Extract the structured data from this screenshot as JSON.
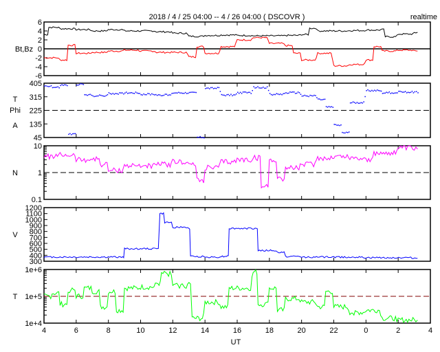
{
  "chart_data": {
    "type": "line",
    "title": "2018 / 4 / 25  04:00 -- 4 / 26  04:00 ( DSCOVR )",
    "mode_label": "realtime",
    "xlabel": "UT",
    "x_ticks": [
      "4",
      "6",
      "8",
      "10",
      "12",
      "14",
      "16",
      "18",
      "20",
      "22",
      "0",
      "2",
      "4"
    ],
    "xlim_hours": [
      4,
      28
    ],
    "panels": [
      {
        "ylabel": "Bt,Bz",
        "scale": "linear",
        "ylim": [
          -6,
          6
        ],
        "ticks": [
          "6",
          "4",
          "2",
          "0",
          "-2",
          "-4",
          "-6"
        ],
        "tick_values": [
          6,
          4,
          2,
          0,
          -2,
          -4,
          -6
        ],
        "ref_line": 0,
        "ref_style": "solid",
        "series": [
          {
            "name": "Bt",
            "color": "#000000",
            "x": [
              4,
              4.3,
              5,
              6,
              7,
              8,
              9,
              10,
              11,
              12,
              13,
              14,
              15,
              16,
              17,
              18,
              19,
              20,
              20.5,
              21,
              22,
              23,
              24,
              25,
              25.2,
              26,
              27,
              27.2
            ],
            "y": [
              3.2,
              4.8,
              4.5,
              4.3,
              4.0,
              4.3,
              4.0,
              4.0,
              3.8,
              3.5,
              2.8,
              3.0,
              3.1,
              3.0,
              2.9,
              2.9,
              3.0,
              3.2,
              4.6,
              4.0,
              4.0,
              4.1,
              4.2,
              4.3,
              2.7,
              3.3,
              3.5,
              3.7
            ]
          },
          {
            "name": "Bz",
            "color": "#ff0000",
            "x": [
              4,
              5,
              5.5,
              6,
              7,
              8,
              9,
              10,
              11,
              12,
              13,
              13.5,
              14,
              15,
              16,
              17,
              18,
              19,
              19.5,
              20,
              21,
              22,
              23,
              24,
              24.5,
              25,
              26,
              27,
              27.2
            ],
            "y": [
              -2,
              -2.5,
              0.8,
              -1,
              -0.8,
              -0.5,
              -0.3,
              -0.5,
              -0.8,
              -0.8,
              -1.8,
              0.5,
              -1,
              0.5,
              2,
              2.5,
              1.2,
              0.7,
              -1,
              -2.5,
              -1,
              -3.8,
              -3.5,
              -2.5,
              0.5,
              -0.5,
              -0.3,
              -0.5,
              -0.5
            ]
          }
        ]
      },
      {
        "ylabel": "T\nPhi\nA",
        "scale": "linear",
        "ylim": [
          45,
          405
        ],
        "ticks": [
          "405",
          "315",
          "225",
          "135",
          "45"
        ],
        "tick_values": [
          405,
          315,
          225,
          135,
          45
        ],
        "ref_line": 225,
        "ref_style": "dashed",
        "series": [
          {
            "name": "Phi",
            "color": "#0000ff",
            "style": "dots",
            "x": [
              4,
              4.5,
              5,
              5.5,
              6,
              6.5,
              7,
              8,
              9,
              10,
              11,
              12,
              13,
              13.5,
              14,
              15,
              16,
              17,
              18,
              19,
              20,
              21,
              21.5,
              22,
              22.5,
              23,
              24,
              25,
              26,
              27,
              27.2
            ],
            "y": [
              390,
              380,
              395,
              70,
              400,
              330,
              325,
              340,
              345,
              335,
              330,
              345,
              345,
              50,
              375,
              330,
              345,
              380,
              335,
              345,
              325,
              300,
              250,
              130,
              80,
              280,
              360,
              345,
              350,
              350,
              345
            ]
          }
        ]
      },
      {
        "ylabel": "N",
        "scale": "log",
        "ylim": [
          0.1,
          10
        ],
        "ticks": [
          "10",
          "1",
          "0.1"
        ],
        "tick_values": [
          10,
          1,
          0.1
        ],
        "ref_line": 1,
        "ref_style": "dashed",
        "series": [
          {
            "name": "N",
            "color": "#ff00ff",
            "x": [
              4,
              5,
              6,
              7,
              7.5,
              8,
              9,
              10,
              11,
              12,
              13,
              13.5,
              14,
              15,
              16,
              17,
              17.5,
              18,
              18.5,
              19,
              20,
              21,
              22,
              23,
              24,
              24.5,
              25,
              26,
              27,
              27.2
            ],
            "y": [
              4,
              4.5,
              3,
              3.2,
              2,
              1.2,
              1.8,
              1.8,
              2,
              2.5,
              2,
              0.5,
              1.5,
              2.5,
              3,
              3.5,
              0.3,
              3,
              0.6,
              1.5,
              2,
              3.5,
              4,
              3.5,
              3,
              5,
              5.5,
              8,
              7.5,
              7.5
            ]
          }
        ]
      },
      {
        "ylabel": "V",
        "scale": "linear",
        "ylim": [
          300,
          1200
        ],
        "ticks": [
          "1200",
          "1100",
          "1000",
          "900",
          "800",
          "700",
          "600",
          "500",
          "400",
          "300"
        ],
        "tick_values": [
          1200,
          1100,
          1000,
          900,
          800,
          700,
          600,
          500,
          400,
          300
        ],
        "series": [
          {
            "name": "V",
            "color": "#0000ff",
            "x": [
              4,
              6,
              8,
              8.9,
              9,
              11,
              11.2,
              11.5,
              12,
              13,
              13.1,
              14,
              15,
              15.4,
              15.5,
              17.2,
              17.3,
              18.5,
              19,
              20,
              24,
              27.2
            ],
            "y": [
              370,
              370,
              370,
              370,
              510,
              520,
              1100,
              950,
              870,
              850,
              380,
              370,
              380,
              400,
              850,
              850,
              480,
              450,
              380,
              370,
              360,
              350
            ]
          }
        ]
      },
      {
        "ylabel": "T",
        "scale": "log",
        "ylim": [
          10000,
          1000000
        ],
        "ticks": [
          "1e+6",
          "1e+5",
          "1e+4"
        ],
        "tick_values": [
          1000000,
          100000,
          10000
        ],
        "ref_line": 100000,
        "ref_style": "dashed",
        "series": [
          {
            "name": "T",
            "color": "#00ff00",
            "x": [
              4,
              4.5,
              5,
              5.5,
              6,
              6.5,
              7,
              7.5,
              8,
              8.5,
              9,
              10,
              11,
              11.3,
              12,
              13,
              13.2,
              14,
              15,
              15.5,
              16,
              17,
              17.3,
              18,
              18.5,
              19,
              20,
              21,
              21.5,
              22,
              23,
              24,
              25,
              26,
              27,
              27.2
            ],
            "y": [
              100000,
              130000,
              50000,
              170000,
              100000,
              200000,
              150000,
              40000,
              150000,
              30000,
              200000,
              220000,
              300000,
              700000,
              250000,
              300000,
              15000,
              60000,
              40000,
              200000,
              200000,
              800000,
              50000,
              200000,
              30000,
              80000,
              60000,
              40000,
              150000,
              40000,
              25000,
              30000,
              15000,
              13000,
              13000,
              13000
            ]
          }
        ]
      }
    ]
  }
}
